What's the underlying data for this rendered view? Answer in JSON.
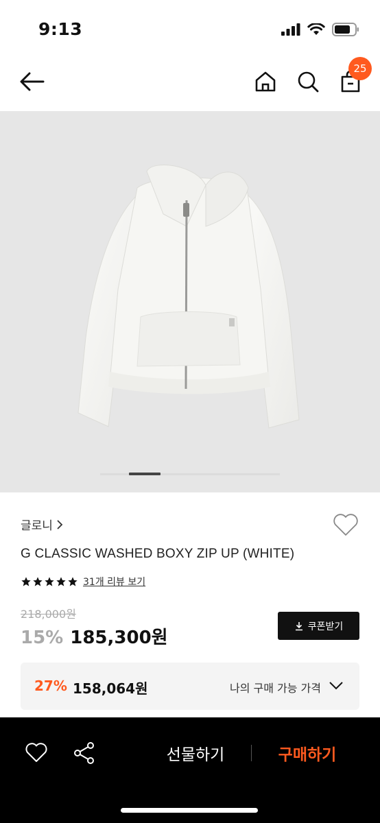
{
  "status_bar": {
    "time": "9:13"
  },
  "header": {
    "cart_count": "25"
  },
  "product": {
    "brand": "글로니",
    "title": "G CLASSIC WASHED BOXY ZIP UP (WHITE)",
    "rating_stars": 5,
    "review_link": "31개 리뷰 보기",
    "original_price": "218,000원",
    "discount_rate": "15%",
    "sale_price": "185,300원",
    "coupon_label": "쿠폰받기",
    "best_price": {
      "rate": "27%",
      "price": "158,064원",
      "label": "나의 구매 가능 가격"
    },
    "image_carousel": {
      "current": 1,
      "total": 5
    }
  },
  "bottom_bar": {
    "gift_label": "선물하기",
    "buy_label": "구매하기"
  },
  "colors": {
    "accent": "#ff5a1f",
    "image_background": "#e6e6e6",
    "bottom_bar": "#000000"
  }
}
